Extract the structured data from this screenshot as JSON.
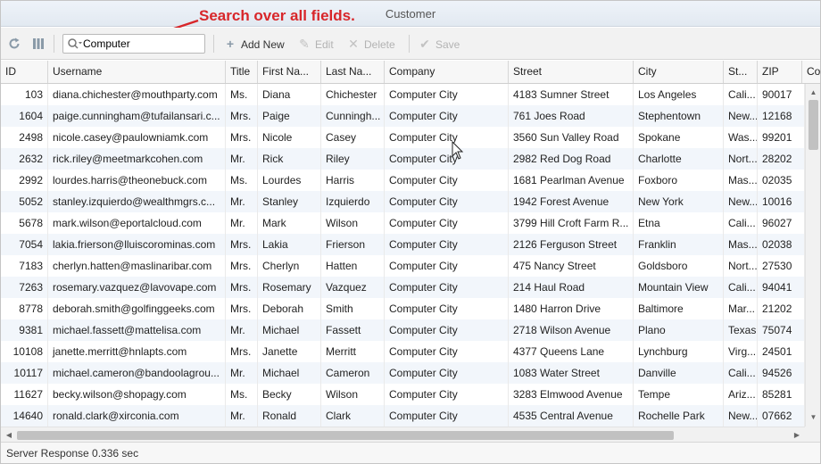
{
  "window": {
    "title": "Customer"
  },
  "annotation": {
    "text": "Search over all fields."
  },
  "toolbar": {
    "refresh_icon": "refresh-icon",
    "columns_icon": "columns-icon",
    "search_value": "Computer",
    "add_label": "Add New",
    "edit_label": "Edit",
    "delete_label": "Delete",
    "save_label": "Save"
  },
  "grid": {
    "columns": [
      "ID",
      "Username",
      "Title",
      "First Na...",
      "Last Na...",
      "Company",
      "Street",
      "City",
      "St...",
      "ZIP",
      "Co"
    ],
    "rows": [
      [
        "103",
        "diana.chichester@mouthparty.com",
        "Ms.",
        "Diana",
        "Chichester",
        "Computer City",
        "4183 Sumner Street",
        "Los Angeles",
        "Cali...",
        "90017"
      ],
      [
        "1604",
        "paige.cunningham@tufailansari.c...",
        "Mrs.",
        "Paige",
        "Cunningh...",
        "Computer City",
        "761 Joes Road",
        "Stephentown",
        "New...",
        "12168"
      ],
      [
        "2498",
        "nicole.casey@paulowniamk.com",
        "Mrs.",
        "Nicole",
        "Casey",
        "Computer City",
        "3560 Sun Valley Road",
        "Spokane",
        "Was...",
        "99201"
      ],
      [
        "2632",
        "rick.riley@meetmarkcohen.com",
        "Mr.",
        "Rick",
        "Riley",
        "Computer City",
        "2982 Red Dog Road",
        "Charlotte",
        "Nort...",
        "28202"
      ],
      [
        "2992",
        "lourdes.harris@theonebuck.com",
        "Ms.",
        "Lourdes",
        "Harris",
        "Computer City",
        "1681 Pearlman Avenue",
        "Foxboro",
        "Mas...",
        "02035"
      ],
      [
        "5052",
        "stanley.izquierdo@wealthmgrs.c...",
        "Mr.",
        "Stanley",
        "Izquierdo",
        "Computer City",
        "1942 Forest Avenue",
        "New York",
        "New...",
        "10016"
      ],
      [
        "5678",
        "mark.wilson@eportalcloud.com",
        "Mr.",
        "Mark",
        "Wilson",
        "Computer City",
        "3799 Hill Croft Farm R...",
        "Etna",
        "Cali...",
        "96027"
      ],
      [
        "7054",
        "lakia.frierson@lluiscorominas.com",
        "Mrs.",
        "Lakia",
        "Frierson",
        "Computer City",
        "2126 Ferguson Street",
        "Franklin",
        "Mas...",
        "02038"
      ],
      [
        "7183",
        "cherlyn.hatten@maslinaribar.com",
        "Mrs.",
        "Cherlyn",
        "Hatten",
        "Computer City",
        "475 Nancy Street",
        "Goldsboro",
        "Nort...",
        "27530"
      ],
      [
        "7263",
        "rosemary.vazquez@lavovape.com",
        "Mrs.",
        "Rosemary",
        "Vazquez",
        "Computer City",
        "214 Haul Road",
        "Mountain View",
        "Cali...",
        "94041"
      ],
      [
        "8778",
        "deborah.smith@golfinggeeks.com",
        "Mrs.",
        "Deborah",
        "Smith",
        "Computer City",
        "1480 Harron Drive",
        "Baltimore",
        "Mar...",
        "21202"
      ],
      [
        "9381",
        "michael.fassett@mattelisa.com",
        "Mr.",
        "Michael",
        "Fassett",
        "Computer City",
        "2718 Wilson Avenue",
        "Plano",
        "Texas",
        "75074"
      ],
      [
        "10108",
        "janette.merritt@hnlapts.com",
        "Mrs.",
        "Janette",
        "Merritt",
        "Computer City",
        "4377 Queens Lane",
        "Lynchburg",
        "Virg...",
        "24501"
      ],
      [
        "10117",
        "michael.cameron@bandoolagrou...",
        "Mr.",
        "Michael",
        "Cameron",
        "Computer City",
        "1083 Water Street",
        "Danville",
        "Cali...",
        "94526"
      ],
      [
        "11627",
        "becky.wilson@shopagy.com",
        "Ms.",
        "Becky",
        "Wilson",
        "Computer City",
        "3283 Elmwood Avenue",
        "Tempe",
        "Ariz...",
        "85281"
      ],
      [
        "14640",
        "ronald.clark@xirconia.com",
        "Mr.",
        "Ronald",
        "Clark",
        "Computer City",
        "4535 Central Avenue",
        "Rochelle Park",
        "New...",
        "07662"
      ]
    ]
  },
  "status": {
    "text": "Server Response 0.336 sec"
  },
  "colors": {
    "annotation": "#d8262a",
    "alt_row": "#f2f6fb",
    "icon": "#8a9aa8"
  }
}
